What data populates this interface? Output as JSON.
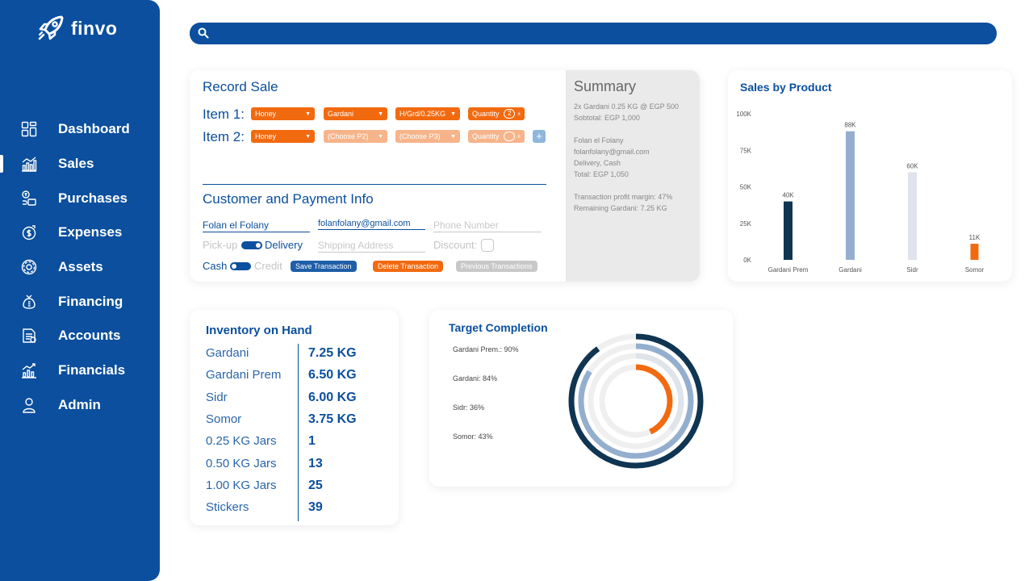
{
  "app": {
    "name": "finvo"
  },
  "sidebar": {
    "items": [
      {
        "label": "Dashboard",
        "icon": "dashboard-icon"
      },
      {
        "label": "Sales",
        "icon": "sales-chart-icon",
        "active": true
      },
      {
        "label": "Purchases",
        "icon": "purchases-icon"
      },
      {
        "label": "Expenses",
        "icon": "expenses-icon"
      },
      {
        "label": "Assets",
        "icon": "assets-gear-icon"
      },
      {
        "label": "Financing",
        "icon": "financing-icon"
      },
      {
        "label": "Accounts",
        "icon": "accounts-icon"
      },
      {
        "label": "Financials",
        "icon": "financials-icon"
      },
      {
        "label": "Admin",
        "icon": "admin-user-icon"
      }
    ]
  },
  "search": {
    "value": "",
    "icon": "search-icon"
  },
  "record_sale": {
    "title": "Record Sale",
    "items": [
      {
        "label": "Item 1:",
        "product": "Honey",
        "variant": "Gardani",
        "size": "H/Grd/0.25KG",
        "quantity_label": "Quantity",
        "quantity": "2"
      },
      {
        "label": "Item 2:",
        "product": "Honey",
        "variant": "(Choose P2)",
        "size": "(Choose P3)",
        "quantity_label": "Quantity",
        "quantity": ""
      }
    ],
    "customer_title": "Customer and Payment Info",
    "customer_name": "Folan el Folany",
    "email": "folanfolany@gmail.com",
    "phone_placeholder": "Phone Number",
    "pickup_label": "Pick-up",
    "delivery_label": "Delivery",
    "shipping_placeholder": "Shipping Address",
    "discount_label": "Discount:",
    "cash_label": "Cash",
    "credit_label": "Credit",
    "save_button": "Save Transaction",
    "delete_button": "Delete Transaction",
    "previous_button": "Previous Transactions"
  },
  "summary": {
    "title": "Summary",
    "lines": [
      "2x Gardani 0.25 KG @ EGP 500",
      "Sobtotal: EGP 1,000",
      "Folan el Folany",
      "folanfolany@gmail.com",
      "Delivery, Cash",
      "Total: EGP 1,050",
      "Transaction profit margin: 47%",
      "Remaining Gardani: 7.25 KG"
    ]
  },
  "chart_data": [
    {
      "type": "bar",
      "title": "Sales by Product",
      "categories": [
        "Gardani Prem",
        "Gardani",
        "Sidr",
        "Somor"
      ],
      "values": [
        40000,
        88000,
        60000,
        11000
      ],
      "data_labels": [
        "40K",
        "88K",
        "60K",
        "11K"
      ],
      "colors": [
        "#0f3552",
        "#94aece",
        "#dfe3ea",
        "#f26a10"
      ],
      "y_ticks": [
        "0K",
        "25K",
        "50K",
        "75K",
        "100K"
      ],
      "ylim": [
        0,
        100000
      ],
      "grid": false
    },
    {
      "type": "radial-bar",
      "title": "Target Completion",
      "categories": [
        "Gardani Prem.",
        "Gardani",
        "Sidr",
        "Somor"
      ],
      "values": [
        90,
        84,
        36,
        43
      ],
      "labels": [
        "Gardani Prem.: 90%",
        "Gardani: 84%",
        "Sidr: 36%",
        "Somor: 43%"
      ],
      "colors": [
        "#0f3552",
        "#94aece",
        "#dfe3ea",
        "#f26a10"
      ]
    }
  ],
  "inventory": {
    "title": "Inventory on Hand",
    "rows": [
      {
        "name": "Gardani",
        "value": "7.25 KG"
      },
      {
        "name": "Gardani Prem",
        "value": "6.50 KG"
      },
      {
        "name": "Sidr",
        "value": "6.00 KG"
      },
      {
        "name": "Somor",
        "value": "3.75 KG"
      },
      {
        "name": "0.25 KG Jars",
        "value": "1"
      },
      {
        "name": "0.50 KG Jars",
        "value": "13"
      },
      {
        "name": "1.00 KG Jars",
        "value": "25"
      },
      {
        "name": "Stickers",
        "value": "39"
      }
    ]
  },
  "colors": {
    "brand": "#0b4f9e",
    "accent": "#f26a10",
    "dark": "#0f3552",
    "muted_blue": "#94aece"
  }
}
